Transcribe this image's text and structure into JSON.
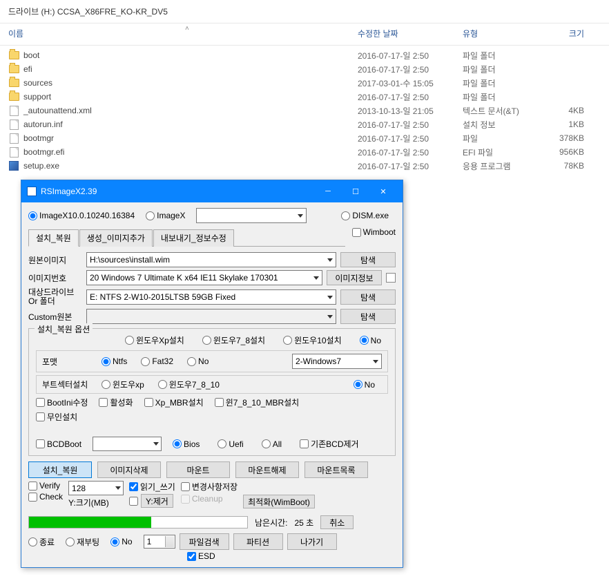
{
  "explorer": {
    "path": "드라이브 (H:) CCSA_X86FRE_KO-KR_DV5",
    "cols": {
      "name": "이름",
      "date": "수정한 날짜",
      "type": "유형",
      "size": "크기"
    },
    "files": [
      {
        "name": "boot",
        "date": "2016-07-17-일 2:50",
        "type": "파일 폴더",
        "size": "",
        "kind": "folder"
      },
      {
        "name": "efi",
        "date": "2016-07-17-일 2:50",
        "type": "파일 폴더",
        "size": "",
        "kind": "folder"
      },
      {
        "name": "sources",
        "date": "2017-03-01-수 15:05",
        "type": "파일 폴더",
        "size": "",
        "kind": "folder"
      },
      {
        "name": "support",
        "date": "2016-07-17-일 2:50",
        "type": "파일 폴더",
        "size": "",
        "kind": "folder"
      },
      {
        "name": "_autounattend.xml",
        "date": "2013-10-13-일 21:05",
        "type": "텍스트 문서(&T)",
        "size": "4KB",
        "kind": "file"
      },
      {
        "name": "autorun.inf",
        "date": "2016-07-17-일 2:50",
        "type": "설치 정보",
        "size": "1KB",
        "kind": "file"
      },
      {
        "name": "bootmgr",
        "date": "2016-07-17-일 2:50",
        "type": "파일",
        "size": "378KB",
        "kind": "file"
      },
      {
        "name": "bootmgr.efi",
        "date": "2016-07-17-일 2:50",
        "type": "EFI 파일",
        "size": "956KB",
        "kind": "file"
      },
      {
        "name": "setup.exe",
        "date": "2016-07-17-일 2:50",
        "type": "응용 프로그램",
        "size": "78KB",
        "kind": "exe"
      }
    ]
  },
  "dialog": {
    "title": "RSImageX2.39",
    "top_radios": {
      "r1": "ImageX10.0.10240.16384",
      "r2": "ImageX",
      "r3": "DISM.exe"
    },
    "wimboot": "Wimboot",
    "tabs": {
      "t1": "설치_복원",
      "t2": "생성_이미지추가",
      "t3": "내보내기_정보수정"
    },
    "labels": {
      "source": "원본이미지",
      "imgno": "이미지번호",
      "target": "대상드라이브\nOr 폴더",
      "custom": "Custom원본"
    },
    "source_val": "H:\\sources\\install.wim",
    "imgno_val": "20  Windows 7 Ultimate K x64 IE11 Skylake 170301",
    "target_val": "E:  NTFS  2-W10-2015LTSB       59GB  Fixed",
    "custom_val": "",
    "btn_browse": "탐색",
    "btn_info": "이미지정보",
    "group_title": "설치_복원 옵션",
    "os_row": {
      "xp": "윈도우Xp설치",
      "w78": "윈도우7_8설치",
      "w10": "윈도우10설치",
      "no": "No"
    },
    "fmt_row": {
      "label": "포맷",
      "ntfs": "Ntfs",
      "fat32": "Fat32",
      "no": "No",
      "dd": "2-Windows7"
    },
    "boot_row": {
      "label": "부트섹터설치",
      "xp": "윈도우xp",
      "w7810": "윈도우7_8_10",
      "no": "No"
    },
    "chk_row": {
      "bootini": "BootIni수정",
      "active": "활성화",
      "xpmbr": "Xp_MBR설치",
      "win7810mbr": "윈7_8_10_MBR설치",
      "unattend": "무인설치"
    },
    "bcd_row": {
      "bcdboot": "BCDBoot",
      "bios": "Bios",
      "uefi": "Uefi",
      "all": "All",
      "remove": "기존BCD제거"
    },
    "action_btns": {
      "install": "설치_복원",
      "delete": "이미지삭제",
      "mount": "마운트",
      "unmount": "마운트해제",
      "mountlist": "마운트목록"
    },
    "verify_row": {
      "verify": "Verify",
      "check": "Check",
      "dd": "128",
      "sizelabel": "Y:크기(MB)",
      "rw": "읽기_쓰기",
      "yremove": "Y:제거",
      "savechanges": "변경사항저장",
      "cleanup": "Cleanup",
      "optimize": "최적화(WimBoot)"
    },
    "progress_row": {
      "remain": "남은시간:",
      "remain_val": "25 초",
      "cancel": "취소"
    },
    "footer": {
      "shutdown": "종료",
      "reboot": "재부팅",
      "no": "No",
      "spin": "1",
      "filesearch": "파일검색",
      "partition": "파티션",
      "exit": "나가기",
      "esd": "ESD"
    }
  }
}
